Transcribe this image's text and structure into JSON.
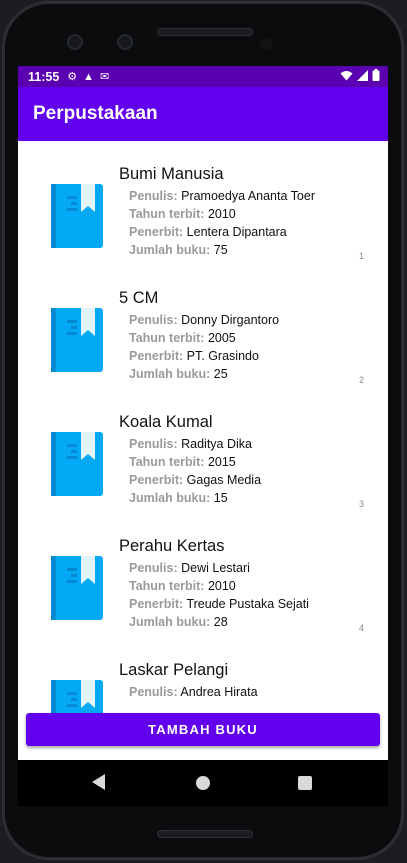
{
  "status": {
    "time": "11:55",
    "icons": [
      "gear-icon",
      "warning-icon",
      "mail-icon"
    ],
    "right_icons": [
      "wifi-icon",
      "signal-icon",
      "battery-icon"
    ]
  },
  "app": {
    "title": "Perpustakaan",
    "accent": "#6200ee",
    "status_color": "#5a00b0"
  },
  "labels": {
    "author": "Penulis:",
    "year": "Tahun terbit:",
    "publisher": "Penerbit:",
    "count": "Jumlah buku:"
  },
  "books": [
    {
      "title": "Bumi Manusia",
      "author": "Pramoedya Ananta Toer",
      "year": "2010",
      "publisher": "Lentera Dipantara",
      "count": "75",
      "num": "1"
    },
    {
      "title": "5 CM",
      "author": "Donny Dirgantoro",
      "year": "2005",
      "publisher": "PT. Grasindo",
      "count": "25",
      "num": "2"
    },
    {
      "title": "Koala Kumal",
      "author": "Raditya Dika",
      "year": "2015",
      "publisher": "Gagas Media",
      "count": "15",
      "num": "3"
    },
    {
      "title": "Perahu Kertas",
      "author": "Dewi Lestari",
      "year": "2010",
      "publisher": "Treude Pustaka Sejati",
      "count": "28",
      "num": "4"
    },
    {
      "title": "Laskar Pelangi",
      "author": "Andrea Hirata",
      "year": "",
      "publisher": "",
      "count": "",
      "num": ""
    }
  ],
  "button": {
    "add_label": "TAMBAH BUKU"
  }
}
